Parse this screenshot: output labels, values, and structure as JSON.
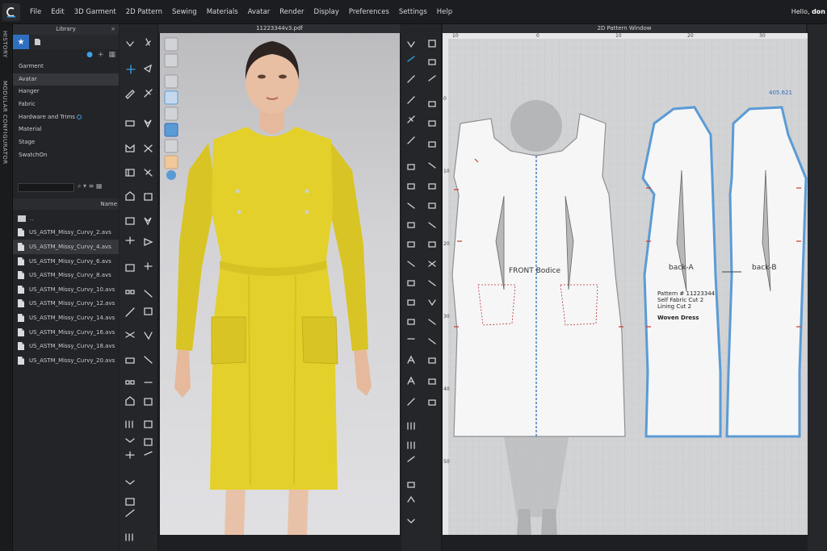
{
  "menu": {
    "items": [
      "File",
      "Edit",
      "3D Garment",
      "2D Pattern",
      "Sewing",
      "Materials",
      "Avatar",
      "Render",
      "Display",
      "Preferences",
      "Settings",
      "Help"
    ],
    "greeting": "Hello, ",
    "user": "don"
  },
  "side_tabs": {
    "history": "HISTORY",
    "configurator": "MODULAR CONFIGURATOR"
  },
  "library": {
    "title": "Library",
    "close": "×",
    "categories": [
      "Garment",
      "Avatar",
      "Hanger",
      "Fabric",
      "Hardware and Trims",
      "Material",
      "Stage",
      "SwatchOn"
    ],
    "selected_category": "Avatar",
    "column_header": "Name",
    "parent_folder": "..",
    "files": [
      "US_ASTM_Missy_Curvy_2.avs",
      "US_ASTM_Missy_Curvy_4.avs",
      "US_ASTM_Missy_Curvy_6.avs",
      "US_ASTM_Missy_Curvy_8.avs",
      "US_ASTM_Missy_Curvy_10.avs",
      "US_ASTM_Missy_Curvy_12.avs",
      "US_ASTM_Missy_Curvy_14.avs",
      "US_ASTM_Missy_Curvy_16.avs",
      "US_ASTM_Missy_Curvy_18.avs",
      "US_ASTM_Missy_Curvy_20.avs"
    ],
    "selected_file": "US_ASTM_Missy_Curvy_4.avs"
  },
  "window3d": {
    "title": "11223344v3.pdf"
  },
  "window2d": {
    "title": "2D Pattern Window",
    "ruler_top": [
      "10",
      "0",
      "10",
      "20",
      "30"
    ],
    "ruler_left": [
      "0",
      "10",
      "20",
      "30",
      "40",
      "50"
    ],
    "measure": "405.621",
    "labels": {
      "front": "FRONT Bodice",
      "back_a": "back-A",
      "back_b": "back-B",
      "annotation": [
        "Pattern # 11223344",
        "Self Fabric Cut 2",
        "Lining Cut 2"
      ],
      "annotation_bold": "Woven Dress"
    }
  },
  "colors": {
    "accent": "#2f6fbf",
    "dress": "#e3d02b",
    "pattern_outline": "#5b9bd5"
  }
}
